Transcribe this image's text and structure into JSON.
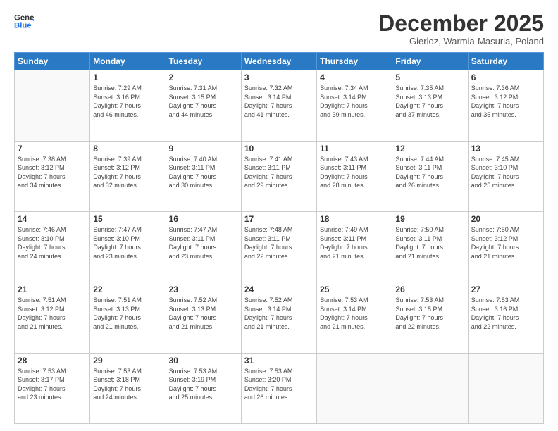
{
  "logo": {
    "line1": "General",
    "line2": "Blue"
  },
  "title": "December 2025",
  "subtitle": "Gierloz, Warmia-Masuria, Poland",
  "weekdays": [
    "Sunday",
    "Monday",
    "Tuesday",
    "Wednesday",
    "Thursday",
    "Friday",
    "Saturday"
  ],
  "weeks": [
    [
      {
        "day": "",
        "info": ""
      },
      {
        "day": "1",
        "info": "Sunrise: 7:29 AM\nSunset: 3:16 PM\nDaylight: 7 hours\nand 46 minutes."
      },
      {
        "day": "2",
        "info": "Sunrise: 7:31 AM\nSunset: 3:15 PM\nDaylight: 7 hours\nand 44 minutes."
      },
      {
        "day": "3",
        "info": "Sunrise: 7:32 AM\nSunset: 3:14 PM\nDaylight: 7 hours\nand 41 minutes."
      },
      {
        "day": "4",
        "info": "Sunrise: 7:34 AM\nSunset: 3:14 PM\nDaylight: 7 hours\nand 39 minutes."
      },
      {
        "day": "5",
        "info": "Sunrise: 7:35 AM\nSunset: 3:13 PM\nDaylight: 7 hours\nand 37 minutes."
      },
      {
        "day": "6",
        "info": "Sunrise: 7:36 AM\nSunset: 3:12 PM\nDaylight: 7 hours\nand 35 minutes."
      }
    ],
    [
      {
        "day": "7",
        "info": "Sunrise: 7:38 AM\nSunset: 3:12 PM\nDaylight: 7 hours\nand 34 minutes."
      },
      {
        "day": "8",
        "info": "Sunrise: 7:39 AM\nSunset: 3:12 PM\nDaylight: 7 hours\nand 32 minutes."
      },
      {
        "day": "9",
        "info": "Sunrise: 7:40 AM\nSunset: 3:11 PM\nDaylight: 7 hours\nand 30 minutes."
      },
      {
        "day": "10",
        "info": "Sunrise: 7:41 AM\nSunset: 3:11 PM\nDaylight: 7 hours\nand 29 minutes."
      },
      {
        "day": "11",
        "info": "Sunrise: 7:43 AM\nSunset: 3:11 PM\nDaylight: 7 hours\nand 28 minutes."
      },
      {
        "day": "12",
        "info": "Sunrise: 7:44 AM\nSunset: 3:11 PM\nDaylight: 7 hours\nand 26 minutes."
      },
      {
        "day": "13",
        "info": "Sunrise: 7:45 AM\nSunset: 3:10 PM\nDaylight: 7 hours\nand 25 minutes."
      }
    ],
    [
      {
        "day": "14",
        "info": "Sunrise: 7:46 AM\nSunset: 3:10 PM\nDaylight: 7 hours\nand 24 minutes."
      },
      {
        "day": "15",
        "info": "Sunrise: 7:47 AM\nSunset: 3:10 PM\nDaylight: 7 hours\nand 23 minutes."
      },
      {
        "day": "16",
        "info": "Sunrise: 7:47 AM\nSunset: 3:11 PM\nDaylight: 7 hours\nand 23 minutes."
      },
      {
        "day": "17",
        "info": "Sunrise: 7:48 AM\nSunset: 3:11 PM\nDaylight: 7 hours\nand 22 minutes."
      },
      {
        "day": "18",
        "info": "Sunrise: 7:49 AM\nSunset: 3:11 PM\nDaylight: 7 hours\nand 21 minutes."
      },
      {
        "day": "19",
        "info": "Sunrise: 7:50 AM\nSunset: 3:11 PM\nDaylight: 7 hours\nand 21 minutes."
      },
      {
        "day": "20",
        "info": "Sunrise: 7:50 AM\nSunset: 3:12 PM\nDaylight: 7 hours\nand 21 minutes."
      }
    ],
    [
      {
        "day": "21",
        "info": "Sunrise: 7:51 AM\nSunset: 3:12 PM\nDaylight: 7 hours\nand 21 minutes."
      },
      {
        "day": "22",
        "info": "Sunrise: 7:51 AM\nSunset: 3:13 PM\nDaylight: 7 hours\nand 21 minutes."
      },
      {
        "day": "23",
        "info": "Sunrise: 7:52 AM\nSunset: 3:13 PM\nDaylight: 7 hours\nand 21 minutes."
      },
      {
        "day": "24",
        "info": "Sunrise: 7:52 AM\nSunset: 3:14 PM\nDaylight: 7 hours\nand 21 minutes."
      },
      {
        "day": "25",
        "info": "Sunrise: 7:53 AM\nSunset: 3:14 PM\nDaylight: 7 hours\nand 21 minutes."
      },
      {
        "day": "26",
        "info": "Sunrise: 7:53 AM\nSunset: 3:15 PM\nDaylight: 7 hours\nand 22 minutes."
      },
      {
        "day": "27",
        "info": "Sunrise: 7:53 AM\nSunset: 3:16 PM\nDaylight: 7 hours\nand 22 minutes."
      }
    ],
    [
      {
        "day": "28",
        "info": "Sunrise: 7:53 AM\nSunset: 3:17 PM\nDaylight: 7 hours\nand 23 minutes."
      },
      {
        "day": "29",
        "info": "Sunrise: 7:53 AM\nSunset: 3:18 PM\nDaylight: 7 hours\nand 24 minutes."
      },
      {
        "day": "30",
        "info": "Sunrise: 7:53 AM\nSunset: 3:19 PM\nDaylight: 7 hours\nand 25 minutes."
      },
      {
        "day": "31",
        "info": "Sunrise: 7:53 AM\nSunset: 3:20 PM\nDaylight: 7 hours\nand 26 minutes."
      },
      {
        "day": "",
        "info": ""
      },
      {
        "day": "",
        "info": ""
      },
      {
        "day": "",
        "info": ""
      }
    ]
  ]
}
